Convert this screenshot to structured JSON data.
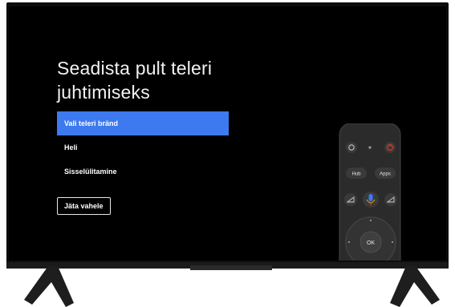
{
  "screen": {
    "title_line1": "Seadista pult teleri",
    "title_line2": "juhtimiseks",
    "menu_items": [
      "Vali teleri bränd",
      "Heli",
      "Sisselülitamine"
    ],
    "skip_label": "Jäta vahele"
  },
  "remote": {
    "hub_label": "Hub",
    "apps_label": "Apps",
    "ok_label": "OK"
  },
  "colors": {
    "accent": "#3d7af0",
    "power": "#c0392b",
    "mic": "#3d7af0"
  }
}
